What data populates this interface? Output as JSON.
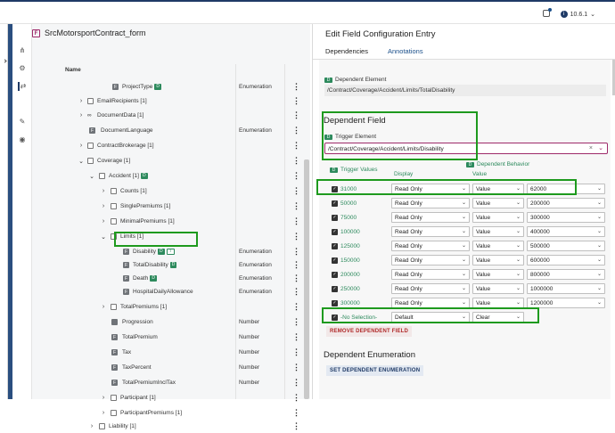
{
  "topbar": {
    "version": "10.6.1"
  },
  "tree": {
    "title": "SrcMotorsportContract_form",
    "column_name": "Name",
    "rows": [
      {
        "label": "ProjectType",
        "badge": "D",
        "type": "Enumeration"
      },
      {
        "label": "EmailRecipients [1]",
        "type": ""
      },
      {
        "label": "DocumentData [1]",
        "type": ""
      },
      {
        "label": "DocumentLanguage",
        "type": "Enumeration"
      },
      {
        "label": "ContractBrokerage [1]",
        "type": ""
      },
      {
        "label": "Coverage [1]",
        "type": ""
      },
      {
        "label": "Accident [1]",
        "badge": "D",
        "type": ""
      },
      {
        "label": "Counts [1]",
        "type": ""
      },
      {
        "label": "SinglePremiums [1]",
        "type": ""
      },
      {
        "label": "MinimalPremiums [1]",
        "type": ""
      },
      {
        "label": "Limits [1]",
        "type": ""
      },
      {
        "label": "Disability",
        "badge": "D",
        "badge2": "T",
        "type": "Enumeration"
      },
      {
        "label": "TotalDisability",
        "badge": "D",
        "type": "Enumeration"
      },
      {
        "label": "Death",
        "badge": "D",
        "type": "Enumeration"
      },
      {
        "label": "HospitalDailyAllowance",
        "type": "Enumeration"
      },
      {
        "label": "TotalPremiums [1]",
        "type": ""
      },
      {
        "label": "Progression",
        "type": "Number"
      },
      {
        "label": "TotalPremium",
        "type": "Number"
      },
      {
        "label": "Tax",
        "type": "Number"
      },
      {
        "label": "TaxPercent",
        "type": "Number"
      },
      {
        "label": "TotalPremiumInclTax",
        "type": "Number"
      },
      {
        "label": "Participant [1]",
        "type": ""
      },
      {
        "label": "ParticipantPremiums [1]",
        "type": ""
      },
      {
        "label": "Liability [1]",
        "type": ""
      }
    ]
  },
  "panel": {
    "title": "Edit Field Configuration Entry",
    "tabs": [
      "Dependencies",
      "Annotations"
    ],
    "dependent_element_label": "Dependent Element",
    "dependent_element_value": "/Contract/Coverage/Accident/Limits/TotalDisability",
    "dependent_field_heading": "Dependent Field",
    "trigger_element_label": "Trigger Element",
    "trigger_element_value": "/Contract/Coverage/Accident/Limits/Disability",
    "trigger_values_label": "Trigger Values",
    "dependent_behavior_label": "Dependent Behavior",
    "display_label": "Display",
    "value_label": "Value",
    "rows": [
      {
        "trigger": "31000",
        "display": "Read Only",
        "mode": "Value",
        "value": "62000"
      },
      {
        "trigger": "50000",
        "display": "Read Only",
        "mode": "Value",
        "value": "200000"
      },
      {
        "trigger": "75000",
        "display": "Read Only",
        "mode": "Value",
        "value": "300000"
      },
      {
        "trigger": "100000",
        "display": "Read Only",
        "mode": "Value",
        "value": "400000"
      },
      {
        "trigger": "125000",
        "display": "Read Only",
        "mode": "Value",
        "value": "500000"
      },
      {
        "trigger": "150000",
        "display": "Read Only",
        "mode": "Value",
        "value": "600000"
      },
      {
        "trigger": "200000",
        "display": "Read Only",
        "mode": "Value",
        "value": "800000"
      },
      {
        "trigger": "250000",
        "display": "Read Only",
        "mode": "Value",
        "value": "1000000"
      },
      {
        "trigger": "300000",
        "display": "Read Only",
        "mode": "Value",
        "value": "1200000"
      },
      {
        "trigger": "-No Selection-",
        "display": "Default",
        "mode": "Clear",
        "value": ""
      }
    ],
    "remove_button": "REMOVE DEPENDENT FIELD",
    "dependent_enumeration_heading": "Dependent Enumeration",
    "set_button": "SET DEPENDENT ENUMERATION"
  }
}
